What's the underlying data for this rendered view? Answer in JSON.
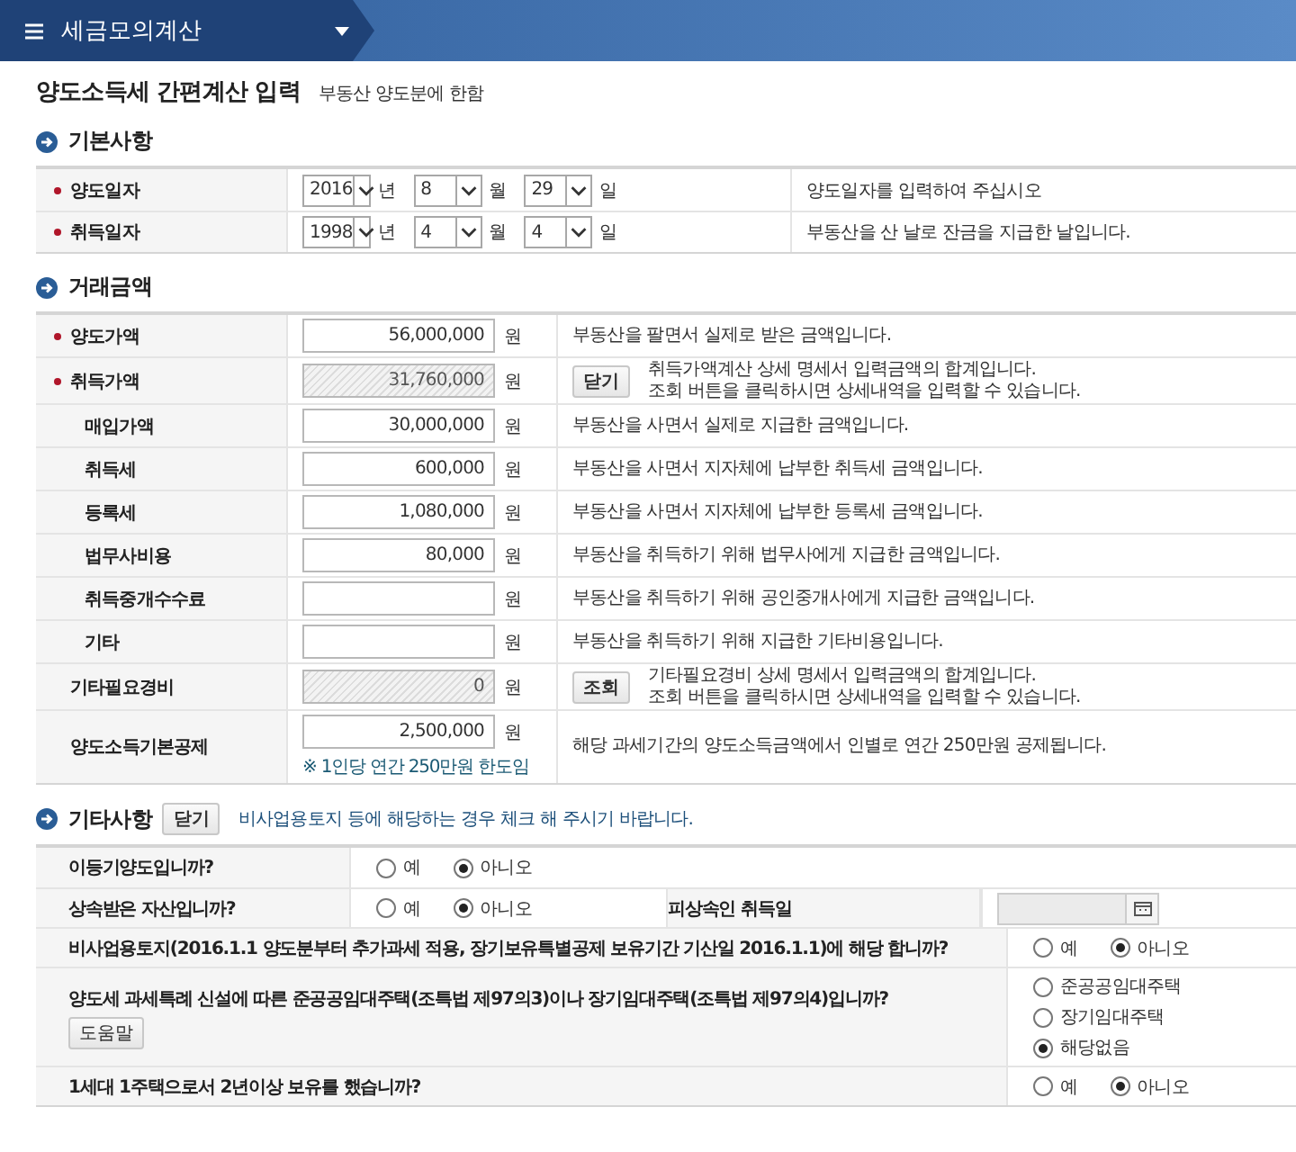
{
  "header": {
    "title": "세금모의계산"
  },
  "page_title": "양도소득세 간편계산 입력",
  "page_subtitle": "부동산 양도분에 한함",
  "basic": {
    "title": "기본사항",
    "rows": [
      {
        "label": "양도일자",
        "required": true,
        "year": "2016",
        "year_unit": "년",
        "month": "8",
        "month_unit": "월",
        "day": "29",
        "day_unit": "일",
        "note": "양도일자를 입력하여 주십시오"
      },
      {
        "label": "취득일자",
        "required": true,
        "year": "1998",
        "year_unit": "년",
        "month": "4",
        "month_unit": "월",
        "day": "4",
        "day_unit": "일",
        "note": "부동산을 산 날로 잔금을 지급한 날입니다."
      }
    ]
  },
  "amounts": {
    "title": "거래금액",
    "rows": [
      {
        "label": "양도가액",
        "required": true,
        "disabled": false,
        "value": "56,000,000",
        "unit": "원",
        "note": [
          "부동산을 팔면서 실제로 받은 금액입니다."
        ]
      },
      {
        "label": "취득가액",
        "required": true,
        "disabled": true,
        "value": "31,760,000",
        "unit": "원",
        "button": "닫기",
        "note": [
          "취득가액계산 상세 명세서 입력금액의 합계입니다.",
          "조회 버튼을 클릭하시면 상세내역을 입력할 수 있습니다."
        ],
        "children": [
          {
            "label": "매입가액",
            "required": false,
            "disabled": false,
            "value": "30,000,000",
            "unit": "원",
            "note": [
              "부동산을 사면서 실제로 지급한 금액입니다."
            ]
          },
          {
            "label": "취득세",
            "required": false,
            "disabled": false,
            "value": "600,000",
            "unit": "원",
            "note": [
              "부동산을 사면서 지자체에 납부한 취득세 금액입니다."
            ]
          },
          {
            "label": "등록세",
            "required": false,
            "disabled": false,
            "value": "1,080,000",
            "unit": "원",
            "note": [
              "부동산을 사면서 지자체에 납부한 등록세 금액입니다."
            ]
          },
          {
            "label": "법무사비용",
            "required": false,
            "disabled": false,
            "value": "80,000",
            "unit": "원",
            "note": [
              "부동산을 취득하기 위해 법무사에게 지급한 금액입니다."
            ]
          },
          {
            "label": "취득중개수수료",
            "required": false,
            "disabled": false,
            "unit": "원",
            "note": [
              "부동산을 취득하기 위해 공인중개사에게 지급한 금액입니다."
            ]
          },
          {
            "label": "기타",
            "required": false,
            "disabled": false,
            "unit": "원",
            "note": [
              "부동산을 취득하기 위해 지급한 기타비용입니다."
            ]
          }
        ]
      },
      {
        "label": "기타필요경비",
        "required": false,
        "disabled": true,
        "value": "0",
        "unit": "원",
        "button": "조회",
        "note": [
          "기타필요경비 상세 명세서 입력금액의 합계입니다.",
          "조회 버튼을 클릭하시면 상세내역을 입력할 수 있습니다."
        ]
      },
      {
        "label": "양도소득기본공제",
        "required": false,
        "disabled": false,
        "value": "2,500,000",
        "unit": "원",
        "hint": "※ 1인당 연간 250만원 한도임",
        "note": [
          "해당 과세기간의 양도소득금액에서 인별로 연간 250만원 공제됩니다."
        ]
      }
    ]
  },
  "other": {
    "title": "기타사항",
    "button": "닫기",
    "note": "비사업용토지 등에 해당하는 경우 체크 해 주시기 바랍니다.",
    "rows": [
      {
        "kind": "radio-inline",
        "question": "이등기양도입니까?",
        "options": [
          {
            "label": "예",
            "selected": false
          },
          {
            "label": "아니오",
            "selected": true
          }
        ]
      },
      {
        "kind": "radio-date",
        "question": "상속받은 자산입니까?",
        "date_label": "피상속인 취득일",
        "options": [
          {
            "label": "예",
            "selected": false
          },
          {
            "label": "아니오",
            "selected": true
          }
        ]
      },
      {
        "kind": "radio",
        "question": "비사업용토지(2016.1.1 양도분부터 추가과세 적용, 장기보유특별공제 보유기간 기산일 2016.1.1)에 해당 합니까?",
        "options": [
          {
            "label": "예",
            "selected": false
          },
          {
            "label": "아니오",
            "selected": true
          }
        ]
      },
      {
        "kind": "radio-stack",
        "question": "양도세 과세특례 신설에 따른 준공공임대주택(조특법 제97의3)이나 장기임대주택(조특법 제97의4)입니까?",
        "help_button": "도움말",
        "options": [
          {
            "label": "준공공임대주택",
            "selected": false
          },
          {
            "label": "장기임대주택",
            "selected": false
          },
          {
            "label": "해당없음",
            "selected": true
          }
        ]
      },
      {
        "kind": "radio",
        "question": "1세대 1주택으로서 2년이상 보유를 했습니까?",
        "options": [
          {
            "label": "예",
            "selected": false
          },
          {
            "label": "아니오",
            "selected": true
          }
        ]
      }
    ]
  }
}
